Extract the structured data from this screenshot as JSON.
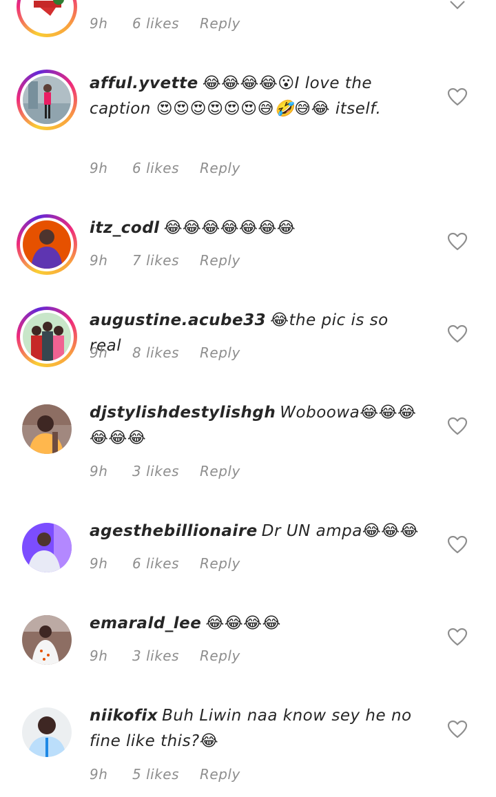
{
  "comments": [
    {
      "id": "partial",
      "username": "",
      "text": "",
      "time": "9h",
      "likes": "6 likes",
      "reply": "Reply",
      "avatar_colors": [
        "#ffffff",
        "#d32f2f"
      ],
      "story_ring": true
    },
    {
      "id": "afful",
      "username": "afful.yvette",
      "text": "😂😂😂😂😮I love the caption 😍😍😍😍😍😍😅🤣😅😂 itself.",
      "time": "9h",
      "likes": "6 likes",
      "reply": "Reply",
      "avatar_colors": [
        "#cfd8dc",
        "#e91e63"
      ],
      "story_ring": true
    },
    {
      "id": "itz",
      "username": "itz_codl",
      "text": "😂😂😂😂😂😂😂",
      "time": "9h",
      "likes": "7 likes",
      "reply": "Reply",
      "avatar_colors": [
        "#e65100",
        "#5e35b1"
      ],
      "story_ring": true
    },
    {
      "id": "augustine",
      "username": "augustine.acube33",
      "text": "😂the pic is so real",
      "time": "9h",
      "likes": "8 likes",
      "reply": "Reply",
      "avatar_colors": [
        "#a5d6a7",
        "#c62828"
      ],
      "story_ring": true
    },
    {
      "id": "dj",
      "username": "djstylishdestylishgh",
      "text": "Woboowa😂😂😂😂😂😂",
      "time": "9h",
      "likes": "3 likes",
      "reply": "Reply",
      "avatar_colors": [
        "#6d4c41",
        "#ffb74d"
      ],
      "story_ring": false
    },
    {
      "id": "ages",
      "username": "agesthebillionaire",
      "text": "Dr UN ampa😂😂😂",
      "time": "9h",
      "likes": "6 likes",
      "reply": "Reply",
      "avatar_colors": [
        "#7c4dff",
        "#311b92"
      ],
      "story_ring": false
    },
    {
      "id": "emarald",
      "username": "emarald_lee",
      "text": "😂😂😂😂",
      "time": "9h",
      "likes": "3 likes",
      "reply": "Reply",
      "avatar_colors": [
        "#8d6e63",
        "#f5f5f5"
      ],
      "story_ring": false
    },
    {
      "id": "niikofix",
      "username": "niikofix",
      "text": "Buh Liwin naa know sey he no fine like this?😂",
      "time": "9h",
      "likes": "5 likes",
      "reply": "Reply",
      "avatar_colors": [
        "#212121",
        "#e3f2fd"
      ],
      "story_ring": false
    }
  ],
  "colors": {
    "text": "#262626",
    "meta": "#8e8e8e",
    "heart": "#8e8e8e"
  }
}
